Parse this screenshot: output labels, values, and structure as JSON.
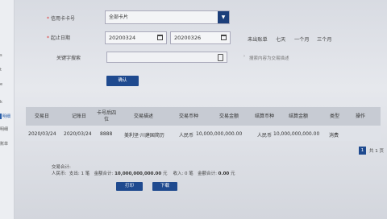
{
  "sidebar": {
    "items": [
      {
        "label": "s"
      },
      {
        "label": "t"
      },
      {
        "label": "e"
      },
      {
        "label": "k"
      },
      {
        "label": "明细",
        "active": true
      },
      {
        "label": "明细"
      },
      {
        "label": "账单"
      }
    ]
  },
  "form": {
    "card_label": "信用卡卡号",
    "card_value": "全部卡片",
    "date_label": "起止日期",
    "start_date": "20200324",
    "end_date": "20200326",
    "quick_ranges": [
      "未出账单",
      "七天",
      "一个月",
      "三个月"
    ],
    "keyword_label": "关键字搜索",
    "keyword_value": "",
    "keyword_hint": "搜索内容为交易描述",
    "confirm_label": "确认"
  },
  "table": {
    "headers": [
      "交易日",
      "记账日",
      "卡号后四位",
      "交易描述",
      "交易币种",
      "交易金额",
      "结算币种",
      "结算金额",
      "类型",
      "操作"
    ],
    "rows": [
      {
        "trade_date": "2020/03/24",
        "post_date": "2020/03/24",
        "card_last4": "8888",
        "desc": "美利坚·川建国简历",
        "currency": "人民币",
        "amount": "10,000,000,000.00",
        "settle_currency": "人民币",
        "settle_amount": "10,000,000,000.00",
        "type": "消费",
        "action": ""
      }
    ]
  },
  "pager": {
    "current": "1",
    "total": "共 1 页"
  },
  "summary": {
    "title": "交易合计:",
    "currency": "人民币:",
    "out_label": "支出: 1 笔",
    "out_amount_label": "金额合计:",
    "out_amount": "10,000,000,000.00",
    "out_unit": "元",
    "in_label": "收入: 0 笔",
    "in_amount_label": "金额合计:",
    "in_amount": "0.00",
    "in_unit": "元"
  },
  "actions": {
    "print_label": "打印",
    "download_label": "下载"
  },
  "colors": {
    "primary": "#1f4a8f",
    "header_bg": "#c7cbd3",
    "required": "#dd3333"
  }
}
